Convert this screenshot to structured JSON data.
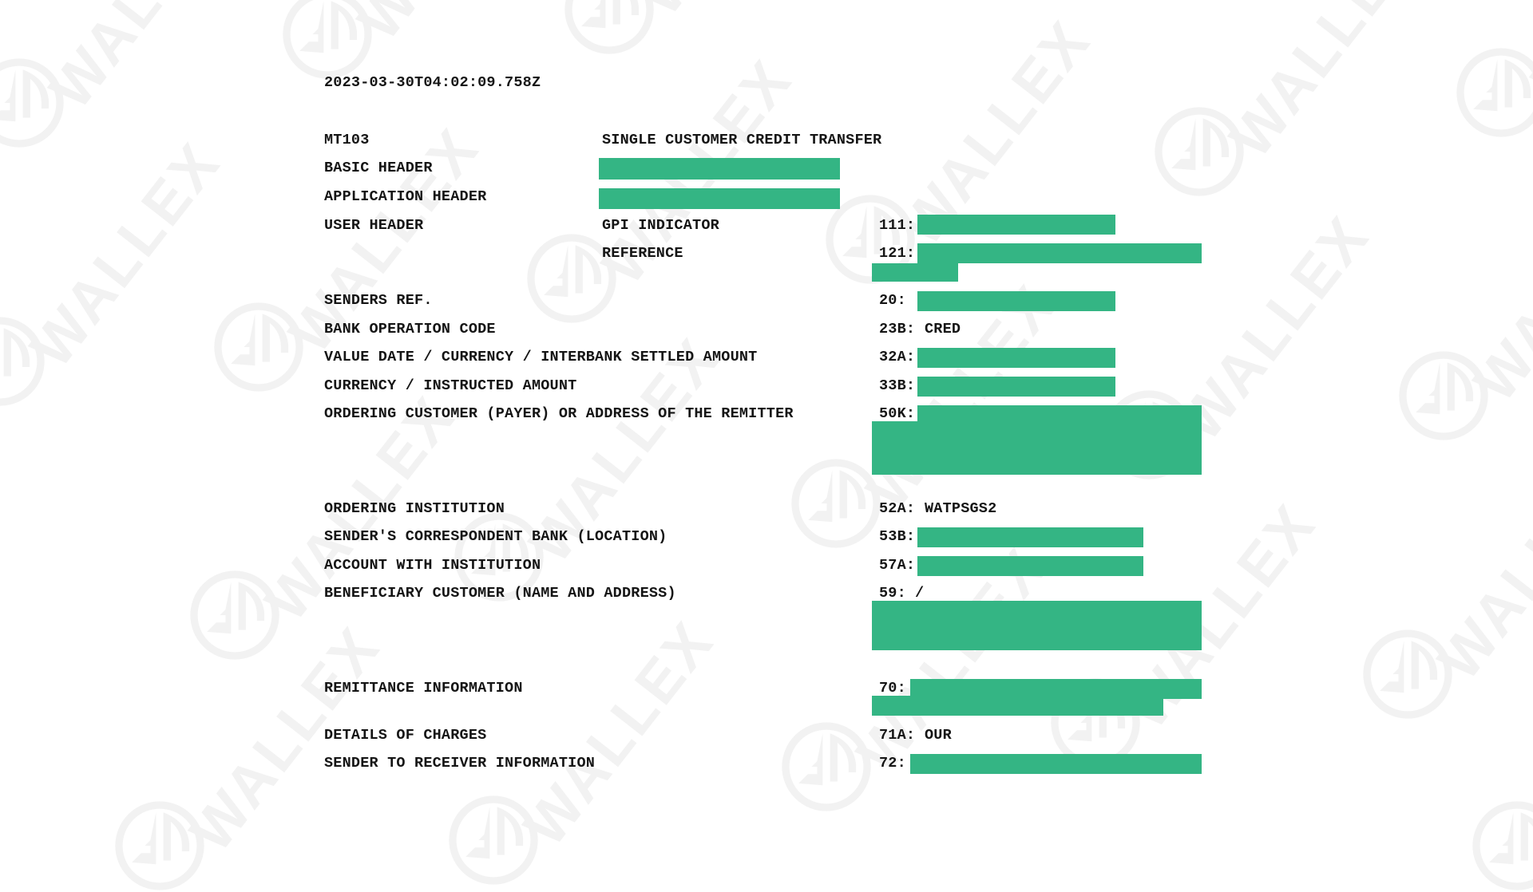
{
  "watermark": {
    "brand_text": "WALLEX",
    "logo_icon": "wallex-circle-logo-icon",
    "color": "#f2f2f2"
  },
  "colors": {
    "redaction": "#34b584",
    "text": "#151515",
    "background": "#ffffff"
  },
  "document": {
    "timestamp": "2023-03-30T04:02:09.758Z",
    "message_type": "MT103",
    "message_type_name": "SINGLE CUSTOMER CREDIT TRANSFER",
    "headers": {
      "basic_header_label": "BASIC HEADER",
      "basic_header_value": "[REDACTED]",
      "application_header_label": "APPLICATION HEADER",
      "application_header_value": "[REDACTED]",
      "user_header_label": "USER HEADER",
      "gpi_indicator_label": "GPI INDICATOR",
      "gpi_indicator_tag": "111:",
      "gpi_indicator_value": "[REDACTED]",
      "reference_label": "REFERENCE",
      "reference_tag": "121:",
      "reference_value": "[REDACTED]"
    },
    "fields": [
      {
        "label": "SENDERS REF.",
        "tag": "20:",
        "value": "[REDACTED]"
      },
      {
        "label": "BANK OPERATION CODE",
        "tag": "23B:",
        "value": "CRED"
      },
      {
        "label": "VALUE DATE / CURRENCY / INTERBANK SETTLED AMOUNT",
        "tag": "32A:",
        "value": "[REDACTED]"
      },
      {
        "label": "CURRENCY / INSTRUCTED AMOUNT",
        "tag": "33B:",
        "value": "[REDACTED]"
      },
      {
        "label": "ORDERING CUSTOMER (PAYER) OR ADDRESS OF THE REMITTER",
        "tag": "50K:",
        "value": "[REDACTED]"
      },
      {
        "label": "ORDERING INSTITUTION",
        "tag": "52A:",
        "value": "WATPSGS2"
      },
      {
        "label": "SENDER'S CORRESPONDENT BANK (LOCATION)",
        "tag": "53B:",
        "value": "[REDACTED]"
      },
      {
        "label": "ACCOUNT WITH INSTITUTION",
        "tag": "57A:",
        "value": "[REDACTED]"
      },
      {
        "label": "BENEFICIARY CUSTOMER (NAME AND ADDRESS)",
        "tag": "59:",
        "value": "/",
        "value_redacted": "[REDACTED]"
      },
      {
        "label": "REMITTANCE INFORMATION",
        "tag": "70:",
        "value": "[REDACTED]"
      },
      {
        "label": "DETAILS OF CHARGES",
        "tag": "71A:",
        "value": "OUR"
      },
      {
        "label": "SENDER TO RECEIVER INFORMATION",
        "tag": "72:",
        "value": "[REDACTED]"
      }
    ]
  }
}
